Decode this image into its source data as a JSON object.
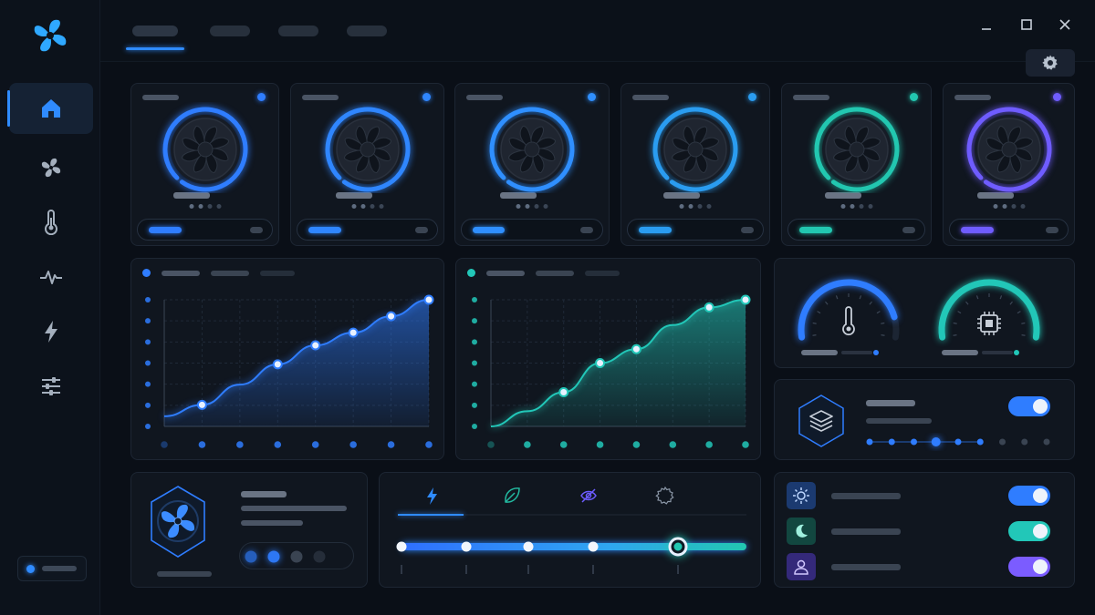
{
  "colors": {
    "accent_blue": "#2f8bff",
    "accent_cyan": "#22c7b8",
    "accent_violet": "#7b5cff",
    "bg": "#0a0f17",
    "card": "#10161f"
  },
  "sidebar": {
    "logo_icon": "fan-logo-icon",
    "items": [
      {
        "icon": "home-icon",
        "active": true
      },
      {
        "icon": "fan-icon",
        "active": false
      },
      {
        "icon": "thermometer-icon",
        "active": false
      },
      {
        "icon": "pulse-icon",
        "active": false
      },
      {
        "icon": "lightning-icon",
        "active": false
      },
      {
        "icon": "sliders-icon",
        "active": false
      }
    ]
  },
  "topbar": {
    "tabs": [
      {
        "active": true
      },
      {
        "active": false
      },
      {
        "active": false
      },
      {
        "active": false
      }
    ],
    "window_controls": [
      "minimize-icon",
      "maximize-icon",
      "close-icon"
    ],
    "settings_icon": "gear-icon"
  },
  "fans": [
    {
      "accent": "#2f7dff",
      "speed_fraction": 0.6,
      "ring_fraction": 0.62
    },
    {
      "accent": "#2f86ff",
      "speed_fraction": 0.6,
      "ring_fraction": 0.64
    },
    {
      "accent": "#2f8fff",
      "speed_fraction": 0.58,
      "ring_fraction": 0.66
    },
    {
      "accent": "#2a9cf0",
      "speed_fraction": 0.6,
      "ring_fraction": 0.66
    },
    {
      "accent": "#22c7b0",
      "speed_fraction": 0.6,
      "ring_fraction": 0.7
    },
    {
      "accent": "#6f5cff",
      "speed_fraction": 0.6,
      "ring_fraction": 0.66
    }
  ],
  "chart_data": [
    {
      "type": "area",
      "color": "#2f7dff",
      "x": [
        0,
        1,
        2,
        3,
        4,
        5,
        6,
        7
      ],
      "y": [
        0.08,
        0.17,
        0.33,
        0.49,
        0.64,
        0.74,
        0.87,
        1.0
      ],
      "marked": [
        1,
        3,
        4,
        5,
        6,
        7
      ],
      "ylim": [
        0,
        1
      ]
    },
    {
      "type": "area",
      "color": "#22c7b8",
      "x": [
        0,
        1,
        2,
        3,
        4,
        5,
        6,
        7
      ],
      "y": [
        0.0,
        0.12,
        0.27,
        0.5,
        0.61,
        0.8,
        0.94,
        1.0
      ],
      "marked": [
        2,
        3,
        4,
        6,
        7
      ],
      "ylim": [
        0,
        1
      ]
    }
  ],
  "gauges": [
    {
      "icon": "thermometer-icon",
      "accent": "#2f7dff",
      "fraction": 0.7
    },
    {
      "icon": "cpu-chip-icon",
      "accent": "#22c7b8",
      "fraction": 0.8
    }
  ],
  "profile": {
    "icon": "layers-icon",
    "enabled": true,
    "step_count": 9,
    "selected_step": 3
  },
  "fan_detail": {
    "icon": "fan-icon",
    "active_dots": 2
  },
  "modes": {
    "tabs": [
      {
        "icon": "lightning-icon",
        "active": true
      },
      {
        "icon": "leaf-icon",
        "active": false
      },
      {
        "icon": "eye-off-icon",
        "active": false
      },
      {
        "icon": "gear-icon",
        "active": false
      }
    ],
    "slider_stops": 5,
    "slider_value_index": 4
  },
  "toggles": [
    {
      "icon": "sun-icon",
      "accent": "#2f7dff",
      "on": true
    },
    {
      "icon": "moon-icon",
      "accent": "#22c7b8",
      "on": true
    },
    {
      "icon": "user-icon",
      "accent": "#7b5cff",
      "on": true
    }
  ]
}
